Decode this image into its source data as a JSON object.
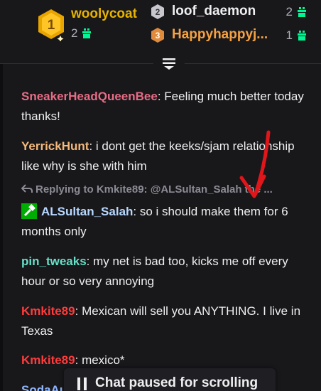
{
  "leaderboard": {
    "first": {
      "rank": "1",
      "name": "woolycoat",
      "count": "2"
    },
    "second": {
      "rank": "2",
      "name": "loof_daemon",
      "count": "2"
    },
    "third": {
      "rank": "3",
      "name": "Happyhappyj...",
      "count": "1"
    }
  },
  "chat": {
    "partial_top": "- . -",
    "messages": [
      {
        "user": "SneakerHeadQueenBee",
        "color": "#e86c85",
        "text": "Feeling much better today thanks!"
      },
      {
        "user": "YerrickHunt",
        "color": "#f5b87a",
        "text": "i dont get the keeks/sjam relationship like why is she with him"
      },
      {
        "user": "ALSultan_Salah",
        "color": "#b7d7ff",
        "text": "so i should make them for 6 months only"
      },
      {
        "user": "pin_tweaks",
        "color": "#66e0c8",
        "text": "my net is bad too, kicks me off every hour or so very annoying"
      },
      {
        "user": "Kmkite89",
        "color": "#ff3b3b",
        "text": "Mexican will sell you ANYTHING. I live in Texas"
      },
      {
        "user": "Kmkite89",
        "color": "#ff3b3b",
        "text": "mexico*"
      },
      {
        "user": "SodaAu",
        "color": "#8fb5ff",
        "text": ""
      }
    ],
    "reply_context": "Replying to Kmkite89: @ALSultan_Salah the ...",
    "separator": ": "
  },
  "pause": {
    "label": "Chat paused for scrolling"
  },
  "colors": {
    "gold": "#e8b300",
    "bronze": "#f5a142",
    "gift": "#00f593",
    "mod_badge": "#00ad03",
    "annotation_arrow": "#e0161b"
  }
}
